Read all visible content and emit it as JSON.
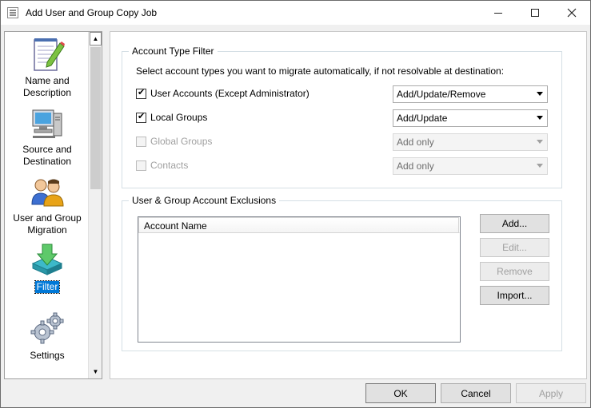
{
  "window": {
    "title": "Add User and Group Copy Job",
    "minimize_icon": "minimize-icon",
    "maximize_icon": "maximize-icon",
    "close_icon": "close-icon"
  },
  "nav": {
    "items": [
      {
        "label": "Name and Description",
        "icon": "notepad-pencil-icon"
      },
      {
        "label": "Source and Destination",
        "icon": "computer-icon"
      },
      {
        "label": "User and Group Migration",
        "icon": "users-icon"
      },
      {
        "label": "Filter",
        "icon": "filter-arrow-icon",
        "selected": true
      },
      {
        "label": "Settings",
        "icon": "gears-icon"
      }
    ]
  },
  "account_filter": {
    "legend": "Account Type Filter",
    "description": "Select account types you want to migrate automatically, if not resolvable at destination:",
    "rows": [
      {
        "label": "User Accounts (Except Administrator)",
        "checked": true,
        "enabled": true,
        "value": "Add/Update/Remove"
      },
      {
        "label": "Local Groups",
        "checked": true,
        "enabled": true,
        "value": "Add/Update"
      },
      {
        "label": "Global Groups",
        "checked": false,
        "enabled": false,
        "value": "Add only"
      },
      {
        "label": "Contacts",
        "checked": false,
        "enabled": false,
        "value": "Add only"
      }
    ]
  },
  "exclusions": {
    "legend": "User & Group Account Exclusions",
    "column_header": "Account Name",
    "buttons": {
      "add": "Add...",
      "edit": "Edit...",
      "remove": "Remove",
      "import": "Import..."
    }
  },
  "footer": {
    "ok": "OK",
    "cancel": "Cancel",
    "apply": "Apply"
  }
}
